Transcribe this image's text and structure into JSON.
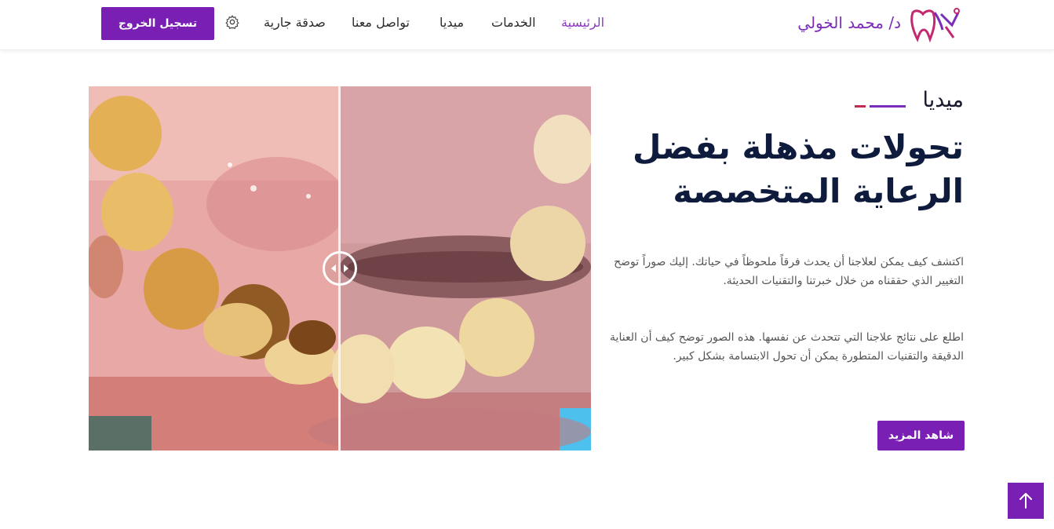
{
  "header": {
    "brand_name": "د/ محمد الخولي",
    "nav_items": [
      {
        "label": "الرئيسية",
        "active": true
      },
      {
        "label": "الخدمات",
        "active": false
      },
      {
        "label": "ميديا",
        "active": false
      },
      {
        "label": "تواصل معنا",
        "active": false
      },
      {
        "label": "صدقة جارية",
        "active": false
      }
    ],
    "settings_icon": "gear-icon",
    "logout_label": "تسجيل الخروج"
  },
  "media_section": {
    "label": "ميديا",
    "heading": "تحولات مذهلة بفضل الرعاية المتخصصة",
    "paragraph_1": "اكتشف كيف يمكن لعلاجنا أن يحدث فرقاً ملحوظاً في حياتك. إليك صوراً توضح التغيير الذي حققناه من خلال خبرتنا والتقنيات الحديثة.",
    "paragraph_2": "اطلع على نتائج علاجنا التي تتحدث عن نفسها. هذه الصور توضح كيف أن العناية الدقيقة والتقنيات المتطورة يمكن أن تحول الابتسامة بشكل كبير.",
    "more_button": "شاهد المزيد"
  },
  "comparison": {
    "handle_icon": "compare-slider-icon",
    "split_position": 0.5
  },
  "scroll_top_icon": "arrow-up-icon",
  "colors": {
    "primary": "#7a1fb4",
    "accent_red": "#c22a52",
    "heading": "#0e1b3d"
  }
}
